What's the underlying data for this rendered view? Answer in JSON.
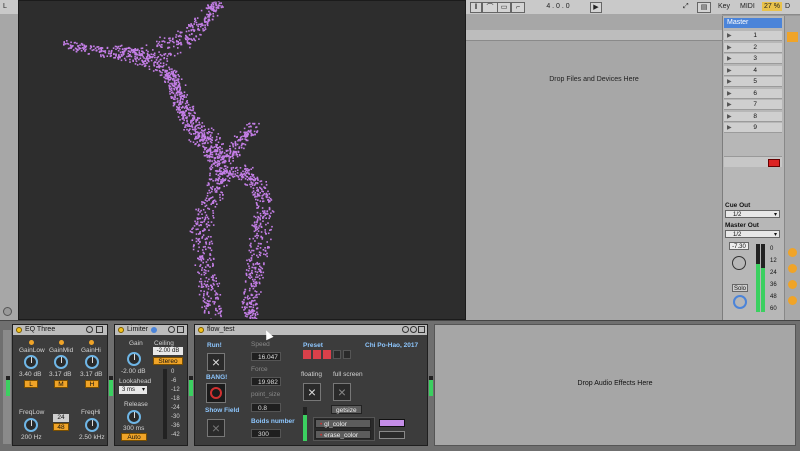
{
  "topbar": {
    "left_label": "L",
    "tempo_display": "4 . 0 . 0",
    "key_label": "Key",
    "midi_label": "MIDI",
    "cpu_percent": "27 %",
    "d_label": "D"
  },
  "session": {
    "drop_files_text": "Drop Files and Devices Here"
  },
  "master": {
    "title": "Master",
    "slots": [
      "1",
      "2",
      "3",
      "4",
      "5",
      "6",
      "7",
      "8",
      "9"
    ],
    "cue_out_label": "Cue Out",
    "cue_out_value": "1/2",
    "master_out_label": "Master Out",
    "master_out_value": "1/2",
    "volume_value": "-7.30",
    "solo_label": "Solo",
    "meter_scale": [
      "0",
      "12",
      "24",
      "36",
      "48",
      "60"
    ]
  },
  "eq_three": {
    "title": "EQ Three",
    "gainlow_label": "GainLow",
    "gainmid_label": "GainMid",
    "gainhi_label": "GainHi",
    "gainlow_value": "3.40 dB",
    "gainmid_value": "3.17 dB",
    "gainhi_value": "3.17 dB",
    "btn_l": "L",
    "btn_m": "M",
    "btn_h": "H",
    "freqlow_label": "FreqLow",
    "freqhi_label": "FreqHi",
    "slope_24": "24",
    "slope_48": "48",
    "freqlow_value": "200 Hz",
    "freqhi_value": "2.50 kHz"
  },
  "limiter": {
    "title": "Limiter",
    "gain_label": "Gain",
    "ceiling_label": "Ceiling",
    "ceiling_value": "-2.00 dB",
    "stereo_label": "Stereo",
    "gain_value": "-2.00 dB",
    "lookahead_label": "Lookahead",
    "lookahead_value": "3 ms",
    "release_label": "Release",
    "release_value": "300 ms",
    "auto_label": "Auto",
    "scale": [
      "0",
      "-6",
      "-12",
      "-18",
      "-24",
      "-30",
      "-36",
      "-42"
    ]
  },
  "flow_test": {
    "title": "flow_test",
    "run_label": "Run!",
    "bang_label": "BANG!",
    "show_field_label": "Show Field",
    "speed_label": "Speed",
    "speed_value": "16.047",
    "force_label": "Force",
    "force_value": "19.982",
    "point_size_label": "point_size",
    "point_size_value": "0.8",
    "boids_number_label": "Boids number",
    "boids_number_value": "300",
    "preset_label": "Preset",
    "author": "Chi Po-Hao, 2017",
    "floating_label": "floating",
    "full_screen_label": "full screen",
    "getsize_label": "getsize",
    "gl_color_label": "gl_color",
    "erase_color_label": "erase_color",
    "gl_color": "#c58ee8",
    "erase_color": "#2a2a2a"
  },
  "drop_audio_text": "Drop Audio Effects Here",
  "colors": {
    "particles": "#c37ee6",
    "accent": "#4b84d9",
    "orange": "#f0a428"
  }
}
